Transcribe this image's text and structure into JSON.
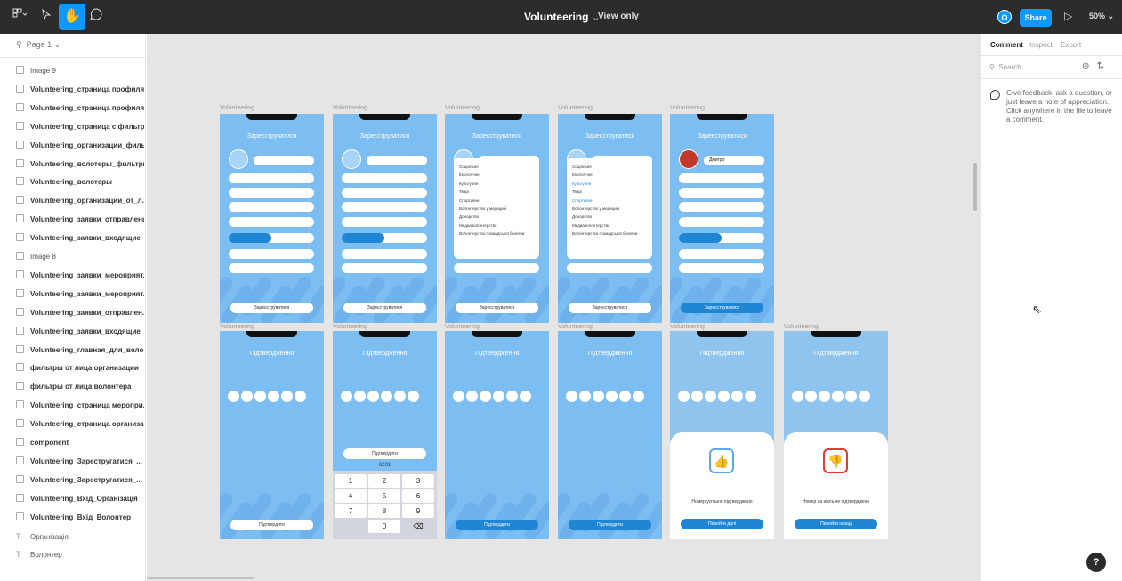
{
  "toolbar": {
    "file_title": "Volunteering",
    "title_chevron": "⌄",
    "view_mode": "View only",
    "avatar_initial": "O",
    "share_label": "Share",
    "zoom": "50%",
    "icons": [
      "figma-menu-icon",
      "move-tool-icon",
      "hand-tool-icon",
      "comment-tool-icon",
      "present-icon"
    ]
  },
  "left_panel": {
    "page_selector": "Page 1",
    "layers": [
      {
        "label": "Image 9",
        "type": "image"
      },
      {
        "label": "Volunteering_страница профиля ...",
        "type": "frame"
      },
      {
        "label": "Volunteering_страница профиля ...",
        "type": "frame"
      },
      {
        "label": "Volunteering_страница с фильтр...",
        "type": "frame"
      },
      {
        "label": "Volunteering_организации_филь...",
        "type": "frame"
      },
      {
        "label": "Volunteering_волотеры_фильтры",
        "type": "frame"
      },
      {
        "label": "Volunteering_волотеры",
        "type": "frame"
      },
      {
        "label": "Volunteering_организации_от_л...",
        "type": "frame"
      },
      {
        "label": "Volunteering_заявки_отправленые",
        "type": "frame"
      },
      {
        "label": "Volunteering_заявки_входящие",
        "type": "frame"
      },
      {
        "label": "Image 8",
        "type": "image"
      },
      {
        "label": "Volunteering_заявки_мероприят...",
        "type": "frame"
      },
      {
        "label": "Volunteering_заявки_мероприят...",
        "type": "frame"
      },
      {
        "label": "Volunteering_заявки_отправлен...",
        "type": "frame"
      },
      {
        "label": "Volunteering_заявки_входящие",
        "type": "frame"
      },
      {
        "label": "Volunteering_главная_для_волон...",
        "type": "frame"
      },
      {
        "label": "фильтры от лица организации",
        "type": "frame"
      },
      {
        "label": "фильтры от лица волонтера",
        "type": "frame"
      },
      {
        "label": "Volunteering_страница меропри...",
        "type": "frame"
      },
      {
        "label": "Volunteering_страница организа...",
        "type": "frame"
      },
      {
        "label": "component",
        "type": "frame"
      },
      {
        "label": "Volunteering_Зарестругатися_...",
        "type": "frame"
      },
      {
        "label": "Volunteering_Зарестругатися_...",
        "type": "frame"
      },
      {
        "label": "Volunteering_Вхід_Організація",
        "type": "frame"
      },
      {
        "label": "Volunteering_Вхід_Волонтер",
        "type": "frame"
      },
      {
        "label": "Організація",
        "type": "text"
      },
      {
        "label": "Волонтер",
        "type": "text"
      }
    ]
  },
  "canvas": {
    "frame_label": "Volunteering",
    "register_title": "Зареєструватися",
    "confirm_title": "Підтвердження",
    "register_button": "Зареєструватися",
    "confirm_button": "Підтвердити",
    "keypad_code": "6201",
    "keypad_keys": [
      "1",
      "2",
      "3",
      "4",
      "5",
      "6",
      "7",
      "8",
      "9",
      "0"
    ],
    "dropdown_items": [
      "Соціальне",
      "Екологічне",
      "Культурне",
      "Тварі",
      "Спортивне",
      "Волонтерство у медицині",
      "Донорство",
      "Медиаволонтерство",
      "Волонтерство громадської безпеки"
    ],
    "success_text": "Номер успішно підтверджено",
    "fail_text": "Номер на жаль не підтверджено",
    "success_button": "Перейти далі",
    "fail_button": "Перейти назад",
    "profile_name": "Дмитро"
  },
  "right_panel": {
    "tabs": [
      "Comment",
      "Inspect",
      "Export"
    ],
    "active_tab": "Comment",
    "search_placeholder": "Search",
    "hint": "Give feedback, ask a question, or just leave a note of appreciation. Click anywhere in the file to leave a comment."
  },
  "help_label": "?",
  "colors": {
    "accent": "#0d99ff",
    "phone_bg": "#7cbdf2",
    "phone_button": "#1f86d6",
    "topbar": "#2c2c2c",
    "canvas": "#e5e5e5"
  }
}
